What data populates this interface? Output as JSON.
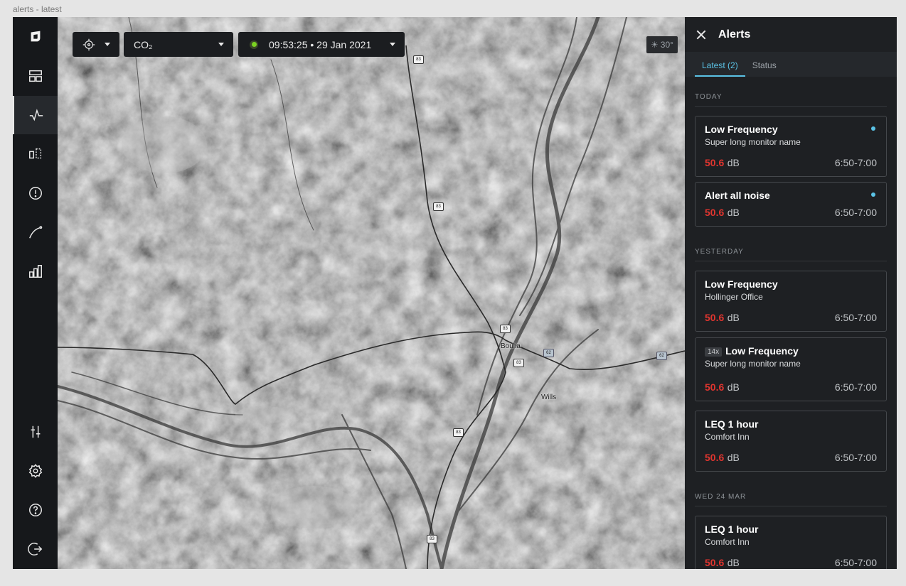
{
  "window_title": "alerts - latest",
  "toolbar": {
    "metric": "CO₂",
    "datetime": "09:53:25 • 29 Jan 2021",
    "status_color": "#7bd321",
    "weather": "30°"
  },
  "map": {
    "towns": [
      "Boulia",
      "Wills"
    ],
    "road_labels": [
      "83",
      "62"
    ]
  },
  "sidebar": {
    "icons": [
      "logo-icon",
      "dashboard-icon",
      "activity-icon",
      "devices-icon",
      "alert-icon",
      "curve-icon",
      "bar-chart-icon",
      "sliders-icon",
      "settings-icon",
      "help-icon",
      "logout-icon"
    ]
  },
  "panel": {
    "title": "Alerts",
    "tabs": [
      "Latest (2)",
      "Status"
    ],
    "sections": [
      "TODAY",
      "YESTERDAY",
      "WED 24 MAR"
    ],
    "cards": [
      {
        "title": "Low Frequency",
        "sub": "Super long monitor name",
        "value": "50.6",
        "unit": "dB",
        "time": "6:50-7:00",
        "badge": "",
        "unread": true
      },
      {
        "title": "Alert all noise",
        "sub": "",
        "value": "50.6",
        "unit": "dB",
        "time": "6:50-7:00",
        "badge": "",
        "unread": true
      },
      {
        "title": "Low Frequency",
        "sub": "Hollinger Office",
        "value": "50.6",
        "unit": "dB",
        "time": "6:50-7:00",
        "badge": "",
        "unread": false
      },
      {
        "title": "Low Frequency",
        "sub": "Super long monitor name",
        "value": "50.6",
        "unit": "dB",
        "time": "6:50-7:00",
        "badge": "14x",
        "unread": false
      },
      {
        "title": "LEQ 1 hour",
        "sub": "Comfort Inn",
        "value": "50.6",
        "unit": "dB",
        "time": "6:50-7:00",
        "badge": "",
        "unread": false
      },
      {
        "title": "LEQ 1 hour",
        "sub": "Comfort Inn",
        "value": "50.6",
        "unit": "dB",
        "time": "6:50-7:00",
        "badge": "",
        "unread": false
      }
    ]
  }
}
